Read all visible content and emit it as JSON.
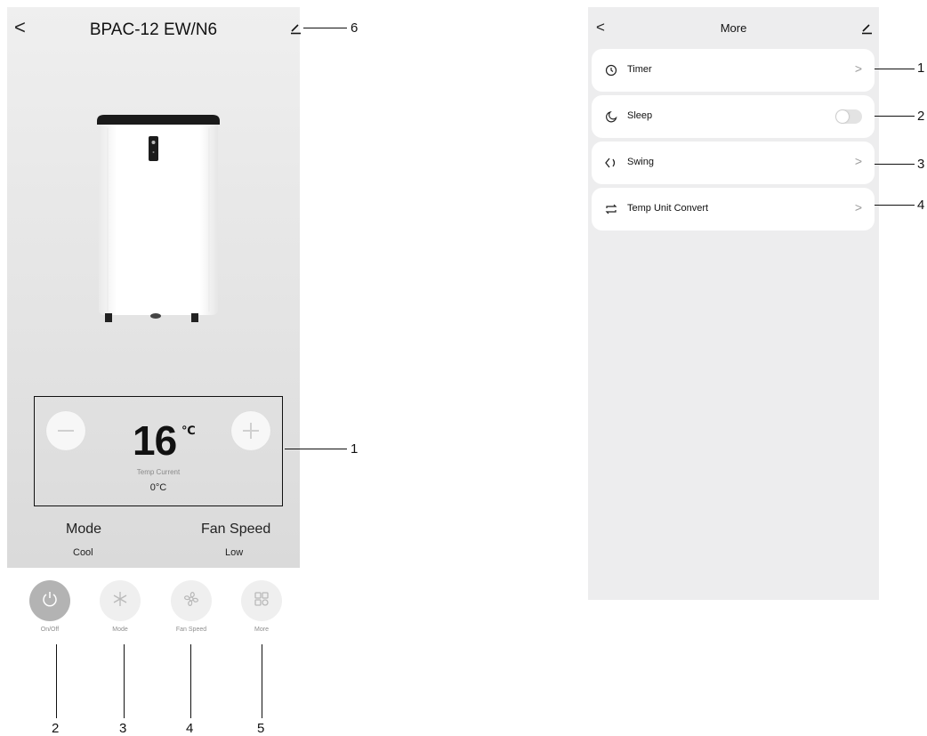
{
  "left_screen": {
    "title": "BPAC-12 EW/N6",
    "temperature": {
      "setpoint": "16",
      "unit": "℃",
      "current_label": "Temp Current",
      "current_value": "0°C"
    },
    "mode": {
      "label": "Mode",
      "value": "Cool"
    },
    "fan_speed": {
      "label": "Fan Speed",
      "value": "Low"
    },
    "buttons": [
      {
        "label": "On/Off",
        "icon": "power-icon"
      },
      {
        "label": "Mode",
        "icon": "snowflake-icon"
      },
      {
        "label": "Fan Speed",
        "icon": "fan-icon"
      },
      {
        "label": "More",
        "icon": "grid-icon"
      }
    ]
  },
  "right_screen": {
    "title": "More",
    "items": [
      {
        "label": "Timer",
        "icon": "clock-icon",
        "control": "chevron"
      },
      {
        "label": "Sleep",
        "icon": "moon-icon",
        "control": "toggle",
        "toggle_on": false
      },
      {
        "label": "Swing",
        "icon": "swing-icon",
        "control": "chevron"
      },
      {
        "label": "Temp Unit Convert",
        "icon": "convert-icon",
        "control": "chevron"
      }
    ]
  },
  "callouts": {
    "left_temp": "1",
    "left_onoff": "2",
    "left_mode": "3",
    "left_fan": "4",
    "left_more": "5",
    "left_edit": "6",
    "right_timer": "1",
    "right_sleep": "2",
    "right_swing": "3",
    "right_convert": "4"
  },
  "glyphs": {
    "back": "<",
    "chevron": ">",
    "minus": "−",
    "plus": "+"
  }
}
